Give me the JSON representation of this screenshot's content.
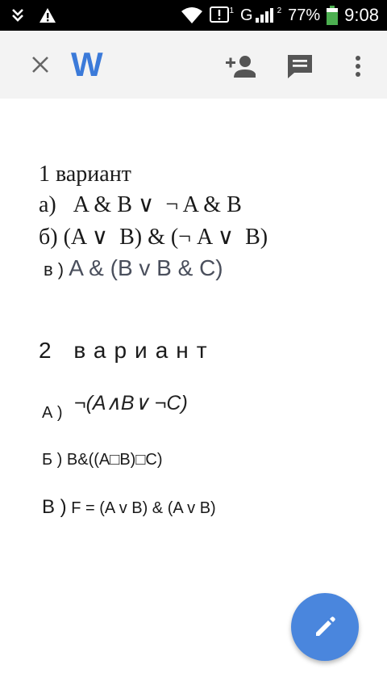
{
  "status_bar": {
    "battery_percent": "77%",
    "time": "9:08",
    "signal_label": "G",
    "sim1": "1",
    "sim2": "2",
    "icons": [
      "download-icon",
      "warning-icon",
      "wifi-icon",
      "alert-box-icon",
      "signal-icon",
      "battery-icon"
    ]
  },
  "toolbar": {
    "logo": "W",
    "icons": [
      "close-icon",
      "add-person-icon",
      "comment-icon",
      "more-vert-icon"
    ],
    "accent_color": "#3b7ad9"
  },
  "document": {
    "variant1": {
      "title": "1 вариант",
      "line_a": "а)   A & B ∨  ¬ A & B",
      "line_b": "б) (A ∨  B) & (¬ A ∨  B)",
      "line_v_label": "в ) ",
      "line_v_expr": "A & (B v B & C)"
    },
    "variant2": {
      "title": "2 вариант",
      "a_label": "А )",
      "a_expr": "¬(A∧B∨ ¬C)",
      "b_line": "Б ) B&((A□B)□C)",
      "v_label": "В )",
      "v_expr": " F = (A v B) & (A v B)"
    }
  },
  "fab": {
    "icon": "pencil-icon",
    "color": "#4a86dd"
  }
}
